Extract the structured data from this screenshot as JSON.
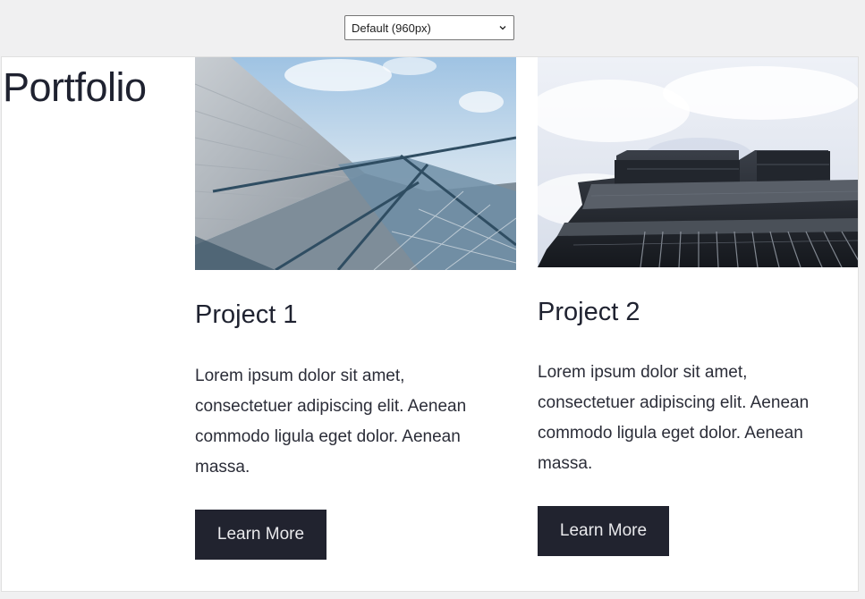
{
  "toolbar": {
    "viewport_select": {
      "value": "Default (960px)",
      "icon": "chevron-down-icon"
    }
  },
  "page": {
    "title": "Portfolio"
  },
  "projects": [
    {
      "image": "building-glass-facade-photo",
      "title": "Project 1",
      "body": "Lorem ipsum dolor sit amet, consectetuer adipiscing elit. Aenean commodo ligula eget dolor. Aenean massa.",
      "button_label": "Learn More"
    },
    {
      "image": "building-skyscraper-clouds-photo",
      "title": "Project 2",
      "body": "Lorem ipsum dolor sit amet, consectetuer adipiscing elit. Aenean commodo ligula eget dolor. Aenean massa.",
      "button_label": "Learn More"
    }
  ],
  "colors": {
    "button_bg": "#21232f",
    "text": "#1f2230",
    "toolbar_bg": "#f0f0f1"
  }
}
